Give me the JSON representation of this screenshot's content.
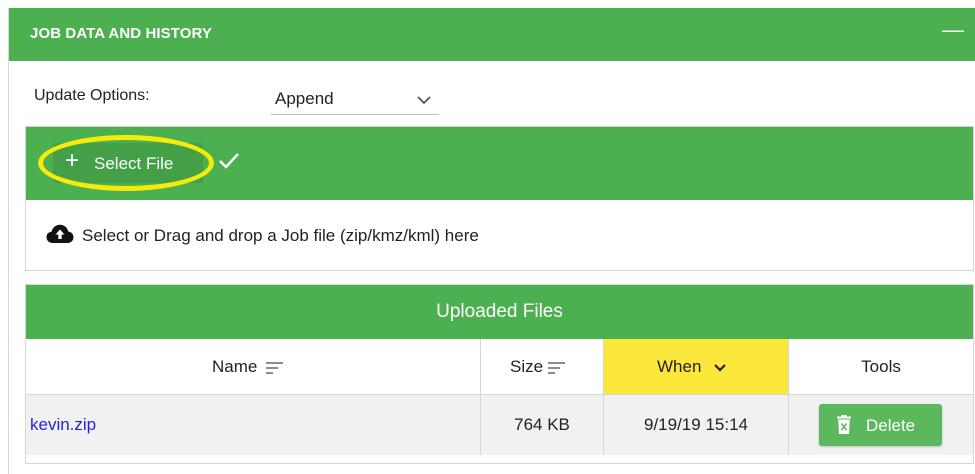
{
  "panel": {
    "title": "JOB DATA AND HISTORY",
    "collapse_symbol": "—"
  },
  "update_options": {
    "label": "Update Options:",
    "selected": "Append",
    "chevron_icon": "chevron-down-icon"
  },
  "upload": {
    "select_file_plus": "+",
    "select_file_label": "Select File",
    "check_icon": "check-icon",
    "drop_icon": "cloud-upload-icon",
    "drop_text": "Select or Drag and drop a Job file (zip/kmz/kml) here",
    "highlight_color": "#f5ec0c"
  },
  "files": {
    "title": "Uploaded Files",
    "columns": {
      "name": "Name",
      "size": "Size",
      "when": "When",
      "tools": "Tools"
    },
    "rows": [
      {
        "name": "kevin.zip",
        "size": "764 KB",
        "when": "9/19/19 15:14",
        "action": "Delete"
      }
    ]
  },
  "colors": {
    "header_green": "#4caf50",
    "button_green": "#5cb85c",
    "when_highlight": "#fbe83a",
    "link_blue": "#2424d6"
  }
}
